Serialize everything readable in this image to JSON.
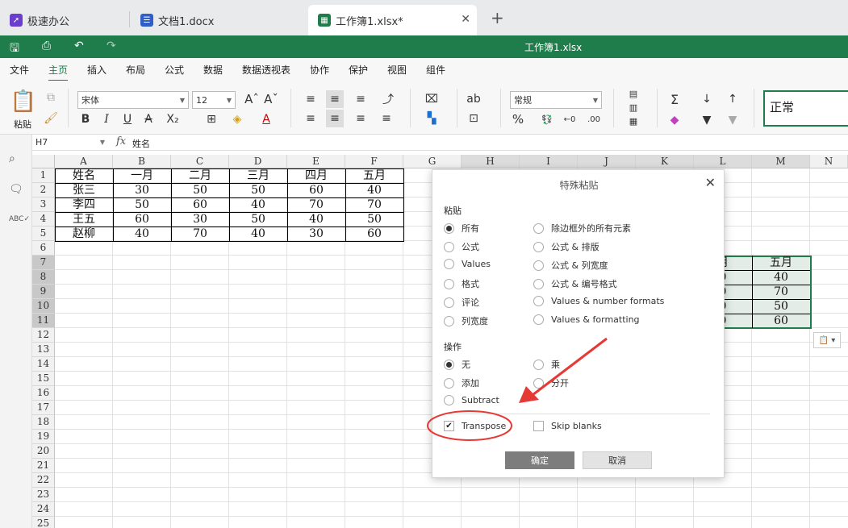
{
  "tabs": [
    {
      "label": "极速办公",
      "icon": "rocket-icon",
      "color": "#6a3fd0"
    },
    {
      "label": "文档1.docx",
      "icon": "doc-icon",
      "color": "#2f5ec9"
    },
    {
      "label": "工作簿1.xlsx*",
      "icon": "sheet-icon",
      "color": "#1e7d4a"
    }
  ],
  "title": "工作簿1.xlsx",
  "menus": [
    "文件",
    "主页",
    "插入",
    "布局",
    "公式",
    "数据",
    "数据透视表",
    "协作",
    "保护",
    "视图",
    "组件"
  ],
  "ribbon": {
    "paste_label": "粘贴",
    "font": "宋体",
    "font_size": "12",
    "number_format": "常规",
    "cell_style": "正常"
  },
  "formula_bar": {
    "cell_ref": "H7",
    "fx": "fx",
    "value": "姓名"
  },
  "columns": [
    "A",
    "B",
    "C",
    "D",
    "E",
    "F",
    "G",
    "H",
    "I",
    "J",
    "K",
    "L",
    "M",
    "N"
  ],
  "rows": [
    "1",
    "2",
    "3",
    "4",
    "5",
    "6",
    "7",
    "8",
    "9",
    "10",
    "11",
    "12",
    "13",
    "14",
    "15",
    "16",
    "17",
    "18",
    "19",
    "20",
    "21",
    "22",
    "23",
    "24",
    "25"
  ],
  "table": [
    [
      "姓名",
      "一月",
      "二月",
      "三月",
      "四月",
      "五月"
    ],
    [
      "张三",
      "30",
      "50",
      "50",
      "60",
      "40"
    ],
    [
      "李四",
      "50",
      "60",
      "40",
      "70",
      "70"
    ],
    [
      "王五",
      "60",
      "30",
      "50",
      "40",
      "50"
    ],
    [
      "赵柳",
      "40",
      "70",
      "40",
      "30",
      "60"
    ]
  ],
  "partial": {
    "l": [
      "月",
      "0",
      "0",
      "0",
      "0"
    ],
    "m": [
      "五月",
      "40",
      "70",
      "50",
      "60"
    ]
  },
  "dialog": {
    "title": "特殊粘贴",
    "paste_section": "粘贴",
    "paste_left": [
      "所有",
      "公式",
      "Values",
      "格式",
      "评论",
      "列宽度"
    ],
    "paste_right": [
      "除边框外的所有元素",
      "公式 & 排版",
      "公式 & 列宽度",
      "公式 & 编号格式",
      "Values & number formats",
      "Values & formatting"
    ],
    "op_section": "操作",
    "op_left": [
      "无",
      "添加",
      "Subtract"
    ],
    "op_right": [
      "乘",
      "分开"
    ],
    "transpose": "Transpose",
    "skip_blanks": "Skip blanks",
    "ok": "确定",
    "cancel": "取消"
  },
  "colors": {
    "accent": "#1e7d4a",
    "annotation": "#e53935"
  }
}
